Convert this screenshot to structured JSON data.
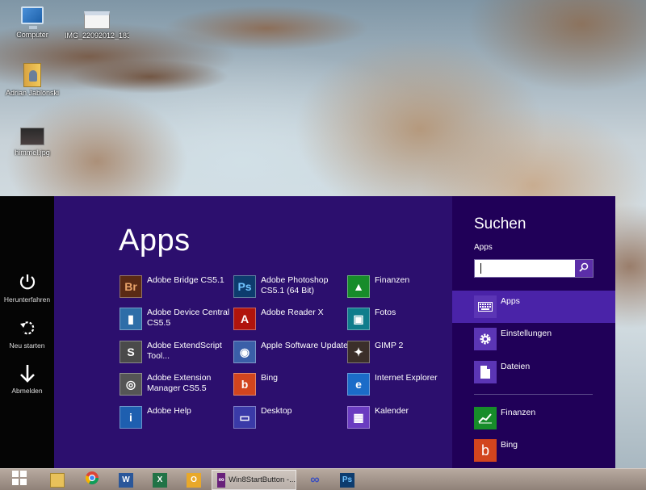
{
  "desktop": {
    "icons": [
      {
        "label": "Computer",
        "icon": "computer-icon"
      },
      {
        "label": "IMG_22092012_1836",
        "icon": "image-file-icon"
      },
      {
        "label": "Adrian Jablonski",
        "icon": "user-folder-icon"
      },
      {
        "label": "himmel.jpg",
        "icon": "image-file-icon"
      }
    ]
  },
  "power": {
    "items": [
      {
        "label": "Herunterfahren",
        "icon": "power-icon"
      },
      {
        "label": "Neu starten",
        "icon": "restart-icon"
      },
      {
        "label": "Abmelden",
        "icon": "sign-out-arrow-icon"
      }
    ]
  },
  "apps_panel": {
    "title": "Apps",
    "apps": [
      {
        "name": "Adobe Bridge CS5.1",
        "icon_text": "Br",
        "color": "#5a2a14"
      },
      {
        "name": "Adobe Device Central CS5.5",
        "icon_text": "▮",
        "color": "#2e6ea8"
      },
      {
        "name": "Adobe ExtendScript Tool...",
        "icon_text": "S",
        "color": "#4a4a4a"
      },
      {
        "name": "Adobe Extension Manager CS5.5",
        "icon_text": "◎",
        "color": "#555555"
      },
      {
        "name": "Adobe Help",
        "icon_text": "i",
        "color": "#1e5fb0"
      },
      {
        "name": "Adobe Photoshop CS5.1 (64 Bit)",
        "icon_text": "Ps",
        "color": "#0d3c6e"
      },
      {
        "name": "Adobe Reader X",
        "icon_text": "A",
        "color": "#b0140c"
      },
      {
        "name": "Apple Software Update",
        "icon_text": "◉",
        "color": "#3a5fa8"
      },
      {
        "name": "Bing",
        "icon_text": "b",
        "color": "#d2451e"
      },
      {
        "name": "Desktop",
        "icon_text": "▭",
        "color": "#3a3aa8"
      },
      {
        "name": "Finanzen",
        "icon_text": "▲",
        "color": "#178c2a"
      },
      {
        "name": "Fotos",
        "icon_text": "▣",
        "color": "#0f7d8c"
      },
      {
        "name": "GIMP 2",
        "icon_text": "✦",
        "color": "#3b2f2a"
      },
      {
        "name": "Internet Explorer",
        "icon_text": "e",
        "color": "#1b6cc8"
      },
      {
        "name": "Kalender",
        "icon_text": "▦",
        "color": "#6a3cc0"
      }
    ]
  },
  "search": {
    "title": "Suchen",
    "scope": "Apps",
    "query": "",
    "filters": [
      {
        "label": "Apps",
        "icon": "keyboard-apps-icon",
        "selected": true
      },
      {
        "label": "Einstellungen",
        "icon": "gear-icon",
        "selected": false
      },
      {
        "label": "Dateien",
        "icon": "document-icon",
        "selected": false
      }
    ],
    "results": [
      {
        "label": "Finanzen",
        "icon": "finance-chart-icon",
        "color": "#178c2a"
      },
      {
        "label": "Bing",
        "icon": "bing-icon",
        "color": "#d2451e"
      }
    ]
  },
  "taskbar": {
    "items": [
      {
        "icon": "windows-start-icon"
      },
      {
        "icon": "file-explorer-icon"
      },
      {
        "icon": "chrome-icon"
      },
      {
        "icon": "word-icon"
      },
      {
        "icon": "excel-icon"
      },
      {
        "icon": "outlook-icon"
      },
      {
        "icon": "visual-studio-icon",
        "label": "Win8StartButton -..."
      },
      {
        "icon": "infinity-app-icon"
      },
      {
        "icon": "photoshop-icon"
      }
    ]
  },
  "colors": {
    "apps_panel_bg": "#2c0f6e",
    "search_pane_bg": "#200058",
    "active_filter_bg": "#4a23a8"
  }
}
